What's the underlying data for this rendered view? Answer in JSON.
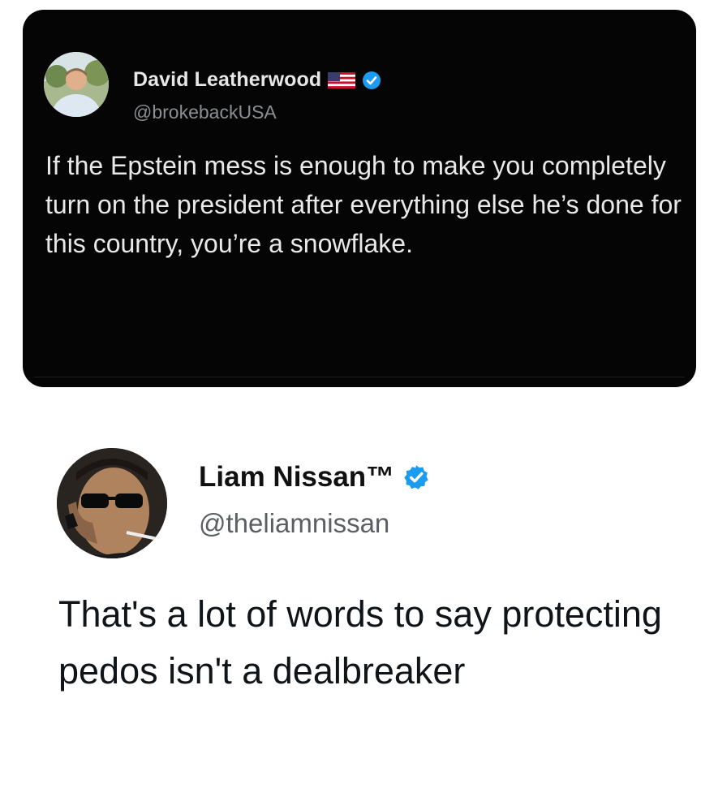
{
  "top_tweet": {
    "author_name": "David Leatherwood",
    "handle": "@brokebackUSA",
    "text": "If the Epstein mess is enough to make you completely turn on the president after everything else he’s done for this country, you’re a snowflake.",
    "icons": [
      "us-flag-icon",
      "verified-badge-icon"
    ],
    "colors": {
      "background": "#050505",
      "text": "#e9e9e9",
      "handle": "#8b8f94",
      "verified": "#1d9bf0"
    }
  },
  "bottom_tweet": {
    "author_name": "Liam Nissan™",
    "handle": "@theliamnissan",
    "text": "That's a lot of words to say protecting pedos isn't a dealbreaker",
    "icons": [
      "verified-badge-icon"
    ],
    "colors": {
      "background": "#ffffff",
      "text": "#0f1419",
      "handle": "#5b5f63",
      "verified": "#1d9bf0"
    }
  }
}
